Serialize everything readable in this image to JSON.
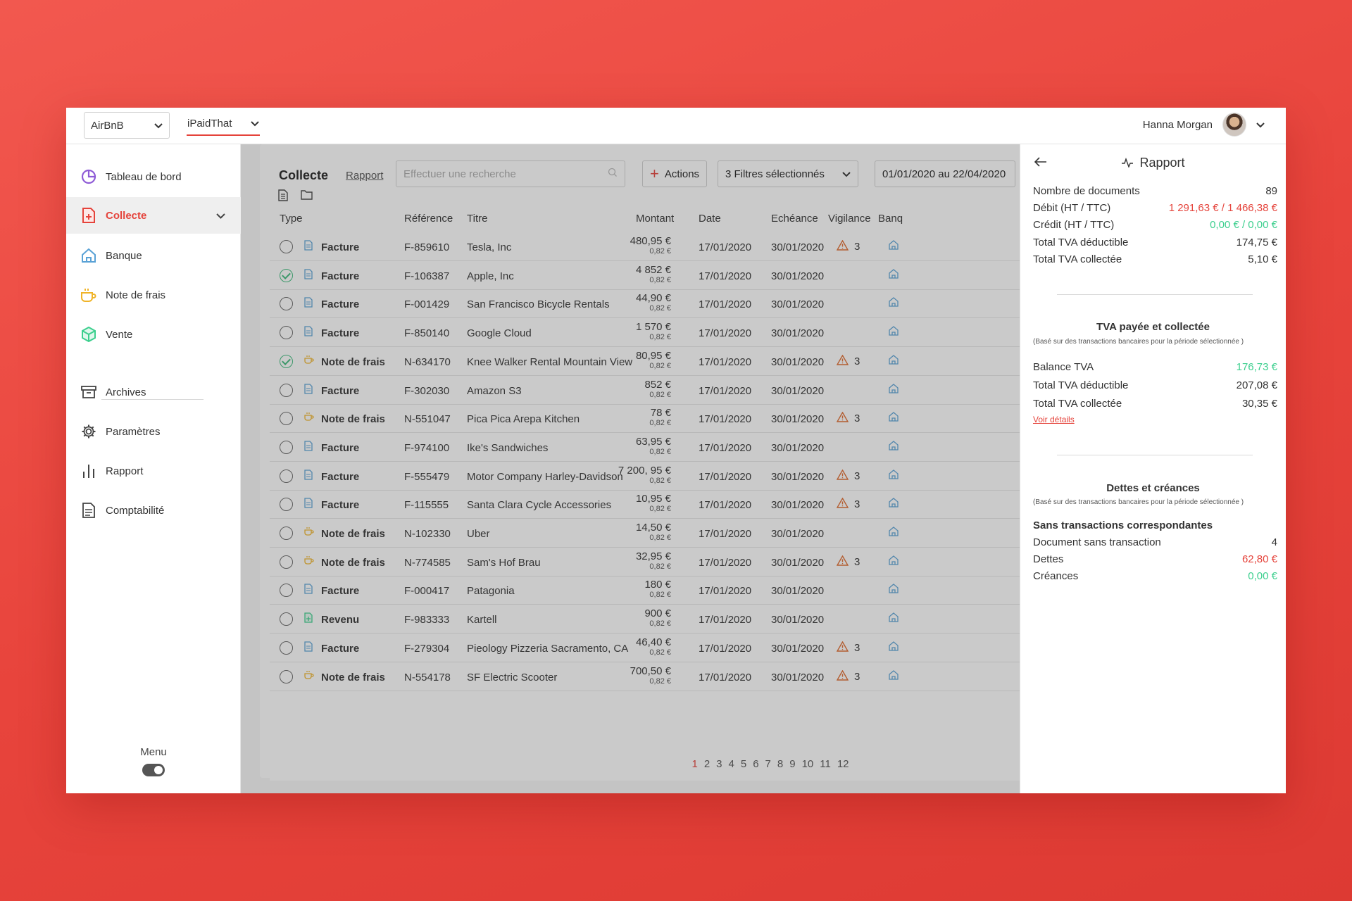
{
  "topbar": {
    "company": "AirBnB",
    "workspace": "iPaidThat",
    "user": "Hanna Morgan"
  },
  "sidebar": {
    "items": [
      {
        "label": "Tableau de bord",
        "icon": "pie-chart-icon"
      },
      {
        "label": "Collecte",
        "icon": "document-plus-icon"
      },
      {
        "label": "Banque",
        "icon": "bank-icon"
      },
      {
        "label": "Note de frais",
        "icon": "coffee-cup-icon"
      },
      {
        "label": "Vente",
        "icon": "cube-icon"
      },
      {
        "label": "Archives",
        "icon": "archive-box-icon"
      },
      {
        "label": "Paramètres",
        "icon": "gear-icon"
      },
      {
        "label": "Rapport",
        "icon": "bar-chart-icon"
      },
      {
        "label": "Comptabilité",
        "icon": "document-icon"
      }
    ],
    "menu_label": "Menu"
  },
  "main": {
    "title": "Collecte",
    "rapport_link": "Rapport",
    "search_placeholder": "Effectuer une recherche",
    "actions": "Actions",
    "filters": "3 Filtres sélectionnés",
    "daterange": "01/01/2020 au 22/04/2020"
  },
  "table": {
    "headers": [
      "Type",
      "Référence",
      "Titre",
      "Montant",
      "Date",
      "Echéance",
      "Vigilance",
      "Banq"
    ],
    "rows": [
      {
        "checked": false,
        "type": "Facture",
        "kind": "invoice",
        "ref": "F-859610",
        "title": "Tesla, Inc",
        "amount": "480,95 €",
        "tax": "0,82 €",
        "date": "17/01/2020",
        "due": "30/01/2020",
        "vig": "3"
      },
      {
        "checked": true,
        "type": "Facture",
        "kind": "invoice",
        "ref": "F-106387",
        "title": "Apple, Inc",
        "amount": "4 852 €",
        "tax": "0,82 €",
        "date": "17/01/2020",
        "due": "30/01/2020",
        "vig": ""
      },
      {
        "checked": false,
        "type": "Facture",
        "kind": "invoice",
        "ref": "F-001429",
        "title": "San Francisco Bicycle Rentals",
        "amount": "44,90 €",
        "tax": "0,82 €",
        "date": "17/01/2020",
        "due": "30/01/2020",
        "vig": ""
      },
      {
        "checked": false,
        "type": "Facture",
        "kind": "invoice",
        "ref": "F-850140",
        "title": "Google Cloud",
        "amount": "1 570 €",
        "tax": "0,82 €",
        "date": "17/01/2020",
        "due": "30/01/2020",
        "vig": ""
      },
      {
        "checked": true,
        "type": "Note de frais",
        "kind": "expense",
        "ref": "N-634170",
        "title": "Knee Walker Rental Mountain View",
        "amount": "80,95 €",
        "tax": "0,82 €",
        "date": "17/01/2020",
        "due": "30/01/2020",
        "vig": "3"
      },
      {
        "checked": false,
        "type": "Facture",
        "kind": "invoice",
        "ref": "F-302030",
        "title": "Amazon S3",
        "amount": "852 €",
        "tax": "0,82 €",
        "date": "17/01/2020",
        "due": "30/01/2020",
        "vig": ""
      },
      {
        "checked": false,
        "type": "Note de frais",
        "kind": "expense",
        "ref": "N-551047",
        "title": "Pica Pica Arepa Kitchen",
        "amount": "78 €",
        "tax": "0,82 €",
        "date": "17/01/2020",
        "due": "30/01/2020",
        "vig": "3"
      },
      {
        "checked": false,
        "type": "Facture",
        "kind": "invoice",
        "ref": "F-974100",
        "title": "Ike's Sandwiches",
        "amount": "63,95 €",
        "tax": "0,82 €",
        "date": "17/01/2020",
        "due": "30/01/2020",
        "vig": ""
      },
      {
        "checked": false,
        "type": "Facture",
        "kind": "invoice",
        "ref": "F-555479",
        "title": "Motor Company Harley-Davidson",
        "amount": "7 200, 95 €",
        "tax": "0,82 €",
        "date": "17/01/2020",
        "due": "30/01/2020",
        "vig": "3"
      },
      {
        "checked": false,
        "type": "Facture",
        "kind": "invoice",
        "ref": "F-115555",
        "title": "Santa Clara Cycle Accessories",
        "amount": "10,95 €",
        "tax": "0,82 €",
        "date": "17/01/2020",
        "due": "30/01/2020",
        "vig": "3"
      },
      {
        "checked": false,
        "type": "Note de frais",
        "kind": "expense",
        "ref": "N-102330",
        "title": "Uber",
        "amount": "14,50 €",
        "tax": "0,82 €",
        "date": "17/01/2020",
        "due": "30/01/2020",
        "vig": ""
      },
      {
        "checked": false,
        "type": "Note de frais",
        "kind": "expense",
        "ref": "N-774585",
        "title": "Sam's Hof Brau",
        "amount": "32,95 €",
        "tax": "0,82 €",
        "date": "17/01/2020",
        "due": "30/01/2020",
        "vig": "3"
      },
      {
        "checked": false,
        "type": "Facture",
        "kind": "invoice",
        "ref": "F-000417",
        "title": "Patagonia",
        "amount": "180 €",
        "tax": "0,82 €",
        "date": "17/01/2020",
        "due": "30/01/2020",
        "vig": ""
      },
      {
        "checked": false,
        "type": "Revenu",
        "kind": "revenue",
        "ref": "F-983333",
        "title": "Kartell",
        "amount": "900 €",
        "tax": "0,82 €",
        "date": "17/01/2020",
        "due": "30/01/2020",
        "vig": ""
      },
      {
        "checked": false,
        "type": "Facture",
        "kind": "invoice",
        "ref": "F-279304",
        "title": "Pieology Pizzeria Sacramento, CA",
        "amount": "46,40 €",
        "tax": "0,82 €",
        "date": "17/01/2020",
        "due": "30/01/2020",
        "vig": "3"
      },
      {
        "checked": false,
        "type": "Note de frais",
        "kind": "expense",
        "ref": "N-554178",
        "title": "SF Electric Scooter",
        "amount": "700,50 €",
        "tax": "0,82 €",
        "date": "17/01/2020",
        "due": "30/01/2020",
        "vig": "3"
      }
    ],
    "pages": [
      "1",
      "2",
      "3",
      "4",
      "5",
      "6",
      "7",
      "8",
      "9",
      "10",
      "11",
      "12"
    ],
    "current_page": "1"
  },
  "panel": {
    "title": "Rapport",
    "summary": [
      {
        "k": "Nombre de documents",
        "v": "89",
        "c": ""
      },
      {
        "k": "Débit (HT / TTC)",
        "v": "1 291,63 € / 1 466,38 €",
        "c": "red"
      },
      {
        "k": "Crédit (HT / TTC)",
        "v": "0,00 € / 0,00 €",
        "c": "green"
      },
      {
        "k": "Total TVA déductible",
        "v": "174,75 €",
        "c": ""
      },
      {
        "k": "Total TVA collectée",
        "v": "5,10 €",
        "c": ""
      }
    ],
    "tva_title": "TVA payée et collectée",
    "tva_note": "(Basé sur des transactions bancaires pour la période sélectionnée )",
    "tva": [
      {
        "k": "Balance TVA",
        "v": "176,73 €",
        "c": "green"
      },
      {
        "k": "Total TVA déductible",
        "v": "207,08 €",
        "c": ""
      },
      {
        "k": "Total TVA collectée",
        "v": "30,35 €",
        "c": ""
      }
    ],
    "details_link": "Voir détails",
    "debts_title": "Dettes et créances",
    "debts_note": "(Basé sur des transactions bancaires pour la période sélectionnée )",
    "debts_subtitle": "Sans transactions correspondantes",
    "debts": [
      {
        "k": "Document sans transaction",
        "v": "4",
        "c": ""
      },
      {
        "k": "Dettes",
        "v": "62,80 €",
        "c": "red"
      },
      {
        "k": "Créances",
        "v": "0,00 €",
        "c": "green"
      }
    ]
  },
  "colors": {
    "accent": "#e5433b",
    "success": "#3ccf8e",
    "warning": "#e06a2c",
    "invoice": "#5aa2d6",
    "expense": "#f0b429"
  }
}
